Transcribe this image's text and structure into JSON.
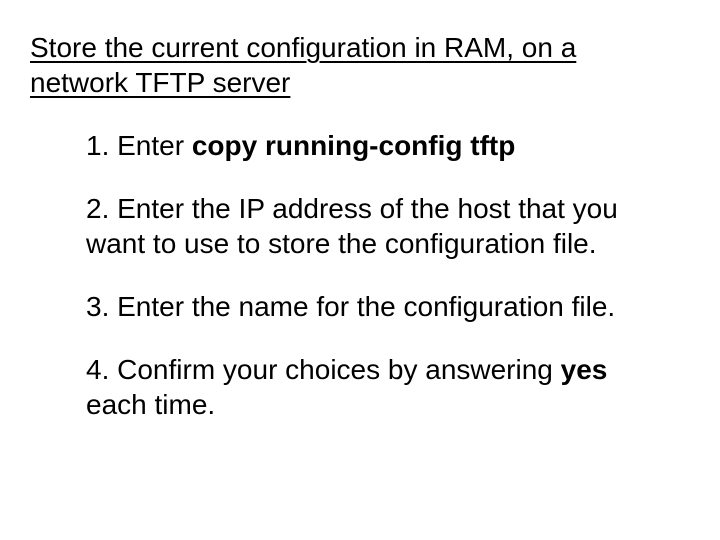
{
  "title": "Store the current configuration in RAM, on a network TFTP server",
  "steps": {
    "s1_prefix": "1. Enter ",
    "s1_bold": "copy running-config tftp",
    "s2": "2. Enter the IP address of the host that you want to use to store the configuration file.",
    "s3": "3. Enter the name for the configuration file.",
    "s4_prefix": "4. Confirm your choices by answering ",
    "s4_bold": "yes",
    "s4_suffix": " each time."
  }
}
